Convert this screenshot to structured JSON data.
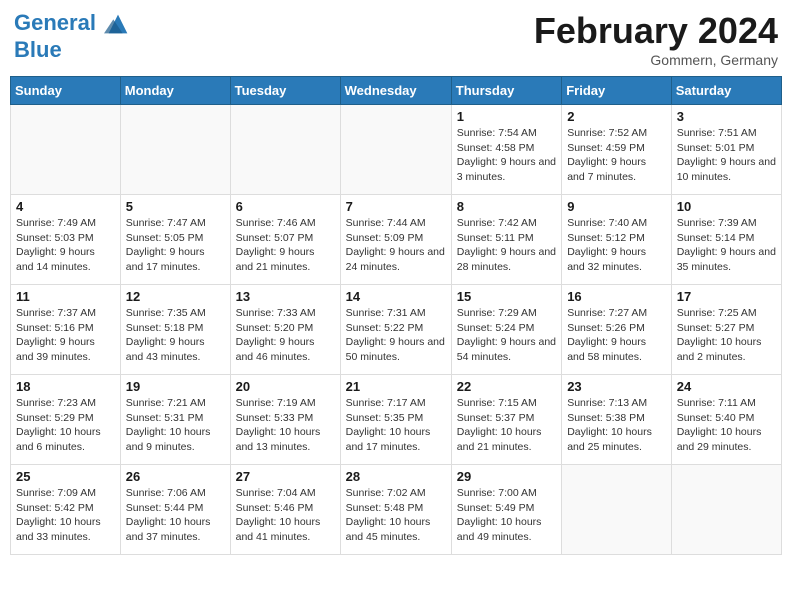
{
  "header": {
    "logo_line1": "General",
    "logo_line2": "Blue",
    "month": "February 2024",
    "location": "Gommern, Germany"
  },
  "weekdays": [
    "Sunday",
    "Monday",
    "Tuesday",
    "Wednesday",
    "Thursday",
    "Friday",
    "Saturday"
  ],
  "weeks": [
    [
      {
        "day": "",
        "info": ""
      },
      {
        "day": "",
        "info": ""
      },
      {
        "day": "",
        "info": ""
      },
      {
        "day": "",
        "info": ""
      },
      {
        "day": "1",
        "info": "Sunrise: 7:54 AM\nSunset: 4:58 PM\nDaylight: 9 hours\nand 3 minutes."
      },
      {
        "day": "2",
        "info": "Sunrise: 7:52 AM\nSunset: 4:59 PM\nDaylight: 9 hours\nand 7 minutes."
      },
      {
        "day": "3",
        "info": "Sunrise: 7:51 AM\nSunset: 5:01 PM\nDaylight: 9 hours\nand 10 minutes."
      }
    ],
    [
      {
        "day": "4",
        "info": "Sunrise: 7:49 AM\nSunset: 5:03 PM\nDaylight: 9 hours\nand 14 minutes."
      },
      {
        "day": "5",
        "info": "Sunrise: 7:47 AM\nSunset: 5:05 PM\nDaylight: 9 hours\nand 17 minutes."
      },
      {
        "day": "6",
        "info": "Sunrise: 7:46 AM\nSunset: 5:07 PM\nDaylight: 9 hours\nand 21 minutes."
      },
      {
        "day": "7",
        "info": "Sunrise: 7:44 AM\nSunset: 5:09 PM\nDaylight: 9 hours\nand 24 minutes."
      },
      {
        "day": "8",
        "info": "Sunrise: 7:42 AM\nSunset: 5:11 PM\nDaylight: 9 hours\nand 28 minutes."
      },
      {
        "day": "9",
        "info": "Sunrise: 7:40 AM\nSunset: 5:12 PM\nDaylight: 9 hours\nand 32 minutes."
      },
      {
        "day": "10",
        "info": "Sunrise: 7:39 AM\nSunset: 5:14 PM\nDaylight: 9 hours\nand 35 minutes."
      }
    ],
    [
      {
        "day": "11",
        "info": "Sunrise: 7:37 AM\nSunset: 5:16 PM\nDaylight: 9 hours\nand 39 minutes."
      },
      {
        "day": "12",
        "info": "Sunrise: 7:35 AM\nSunset: 5:18 PM\nDaylight: 9 hours\nand 43 minutes."
      },
      {
        "day": "13",
        "info": "Sunrise: 7:33 AM\nSunset: 5:20 PM\nDaylight: 9 hours\nand 46 minutes."
      },
      {
        "day": "14",
        "info": "Sunrise: 7:31 AM\nSunset: 5:22 PM\nDaylight: 9 hours\nand 50 minutes."
      },
      {
        "day": "15",
        "info": "Sunrise: 7:29 AM\nSunset: 5:24 PM\nDaylight: 9 hours\nand 54 minutes."
      },
      {
        "day": "16",
        "info": "Sunrise: 7:27 AM\nSunset: 5:26 PM\nDaylight: 9 hours\nand 58 minutes."
      },
      {
        "day": "17",
        "info": "Sunrise: 7:25 AM\nSunset: 5:27 PM\nDaylight: 10 hours\nand 2 minutes."
      }
    ],
    [
      {
        "day": "18",
        "info": "Sunrise: 7:23 AM\nSunset: 5:29 PM\nDaylight: 10 hours\nand 6 minutes."
      },
      {
        "day": "19",
        "info": "Sunrise: 7:21 AM\nSunset: 5:31 PM\nDaylight: 10 hours\nand 9 minutes."
      },
      {
        "day": "20",
        "info": "Sunrise: 7:19 AM\nSunset: 5:33 PM\nDaylight: 10 hours\nand 13 minutes."
      },
      {
        "day": "21",
        "info": "Sunrise: 7:17 AM\nSunset: 5:35 PM\nDaylight: 10 hours\nand 17 minutes."
      },
      {
        "day": "22",
        "info": "Sunrise: 7:15 AM\nSunset: 5:37 PM\nDaylight: 10 hours\nand 21 minutes."
      },
      {
        "day": "23",
        "info": "Sunrise: 7:13 AM\nSunset: 5:38 PM\nDaylight: 10 hours\nand 25 minutes."
      },
      {
        "day": "24",
        "info": "Sunrise: 7:11 AM\nSunset: 5:40 PM\nDaylight: 10 hours\nand 29 minutes."
      }
    ],
    [
      {
        "day": "25",
        "info": "Sunrise: 7:09 AM\nSunset: 5:42 PM\nDaylight: 10 hours\nand 33 minutes."
      },
      {
        "day": "26",
        "info": "Sunrise: 7:06 AM\nSunset: 5:44 PM\nDaylight: 10 hours\nand 37 minutes."
      },
      {
        "day": "27",
        "info": "Sunrise: 7:04 AM\nSunset: 5:46 PM\nDaylight: 10 hours\nand 41 minutes."
      },
      {
        "day": "28",
        "info": "Sunrise: 7:02 AM\nSunset: 5:48 PM\nDaylight: 10 hours\nand 45 minutes."
      },
      {
        "day": "29",
        "info": "Sunrise: 7:00 AM\nSunset: 5:49 PM\nDaylight: 10 hours\nand 49 minutes."
      },
      {
        "day": "",
        "info": ""
      },
      {
        "day": "",
        "info": ""
      }
    ]
  ]
}
